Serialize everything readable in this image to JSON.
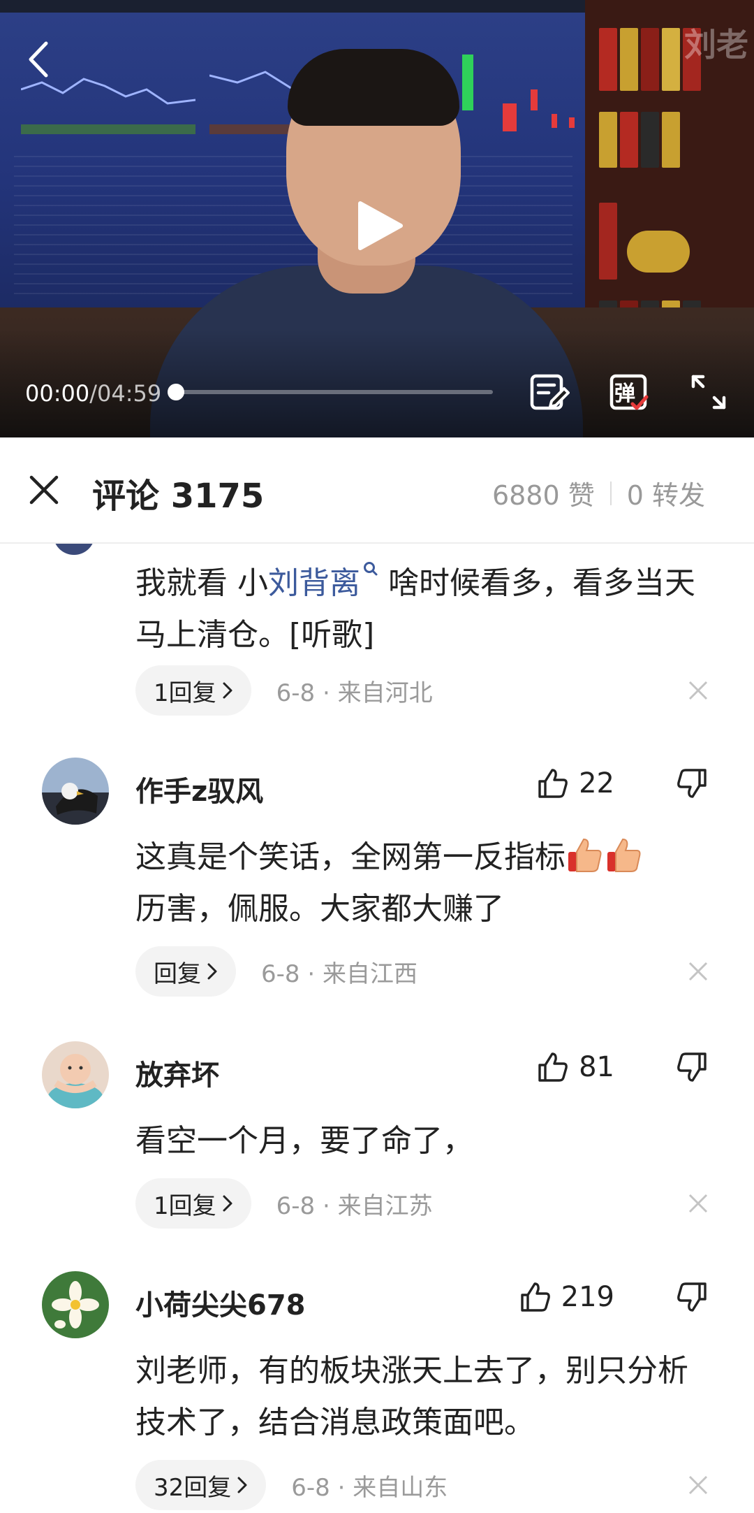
{
  "video": {
    "watermark": "刘老",
    "current_time": "00:00",
    "duration": "/04:59",
    "progress_fraction": 0.0,
    "icons": [
      "back-arrow-icon",
      "play-icon",
      "notes-edit-icon",
      "danmaku-icon",
      "fullscreen-icon"
    ],
    "danmaku_label": "弹"
  },
  "header": {
    "title": "评论 3175",
    "likes": "6880 赞",
    "shares": "0 转发"
  },
  "comments": [
    {
      "text_before": "我就看 小",
      "mention": "刘背离",
      "text_after": " 啥时候看多，看多当天马上清仓。[听歌]",
      "reply_label": "1回复",
      "meta": "6-8 · 来自河北"
    },
    {
      "username": "作手z驭风",
      "likes": "22",
      "text": "这真是个笑话，全网第一反指标",
      "text_line2": "历害，佩服。大家都大赚了",
      "reply_label": "回复",
      "meta": "6-8 · 来自江西"
    },
    {
      "username": "放弃坏",
      "likes": "81",
      "text": "看空一个月，要了命了，",
      "reply_label": "1回复",
      "meta": "6-8 · 来自江苏"
    },
    {
      "username": "小荷尖尖678",
      "likes": "219",
      "text": "刘老师，有的板块涨天上去了，别只分析技术了，结合消息政策面吧。",
      "reply_label": "32回复",
      "meta": "6-8 · 来自山东"
    }
  ],
  "colors": {
    "mention": "#3c5a9c",
    "meta": "#9a9a9a",
    "pill_bg": "#f3f3f3"
  }
}
